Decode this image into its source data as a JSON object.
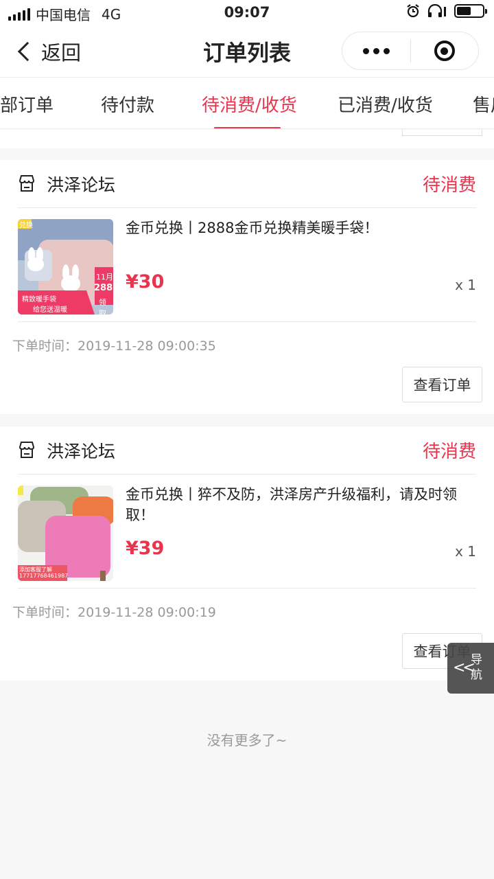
{
  "status_bar": {
    "carrier": "中国电信",
    "network": "4G",
    "time": "09:07",
    "battery_level": 0.55,
    "icons": [
      "signal-icon",
      "alarm-icon",
      "headphones-icon",
      "battery-icon"
    ]
  },
  "nav": {
    "back_label": "返回",
    "title": "订单列表",
    "capsule_icons": [
      "more-icon",
      "close-target-icon"
    ]
  },
  "tabs": [
    {
      "label": "部订单",
      "active": false
    },
    {
      "label": "待付款",
      "active": false
    },
    {
      "label": "待消费/收货",
      "active": true
    },
    {
      "label": "已消费/收货",
      "active": false
    },
    {
      "label": "售后",
      "active": false
    }
  ],
  "orders": [
    {
      "shop": "洪泽论坛",
      "status": "待消费",
      "title": "金币兑换丨2888金币兑换精美暖手袋！",
      "price": "¥30",
      "quantity": "x 1",
      "time_label": "下单时间：",
      "time": "2019-11-28 09:00:35",
      "action": "查看订单",
      "thumb": {
        "badge": "兑换",
        "tag_top": "11月2",
        "tag_num": "288",
        "tag_bottom": "领取",
        "line1": "精致暖手袋",
        "line2": "给您送温暖"
      }
    },
    {
      "shop": "洪泽论坛",
      "status": "待消费",
      "title": "金币兑换丨猝不及防，洪泽房产升级福利，请及时领取！",
      "price": "¥39",
      "quantity": "x 1",
      "time_label": "下单时间：",
      "time": "2019-11-28 09:00:19",
      "action": "查看订单",
      "thumb": {
        "line1": "添加客服了解",
        "line2": "17717768461987"
      }
    }
  ],
  "footer": "没有更多了~",
  "float_nav": {
    "label": "导航",
    "icon": "double-chevron-left-icon"
  },
  "colors": {
    "accent": "#e8344d",
    "muted": "#999999",
    "background": "#f7f7f7"
  }
}
